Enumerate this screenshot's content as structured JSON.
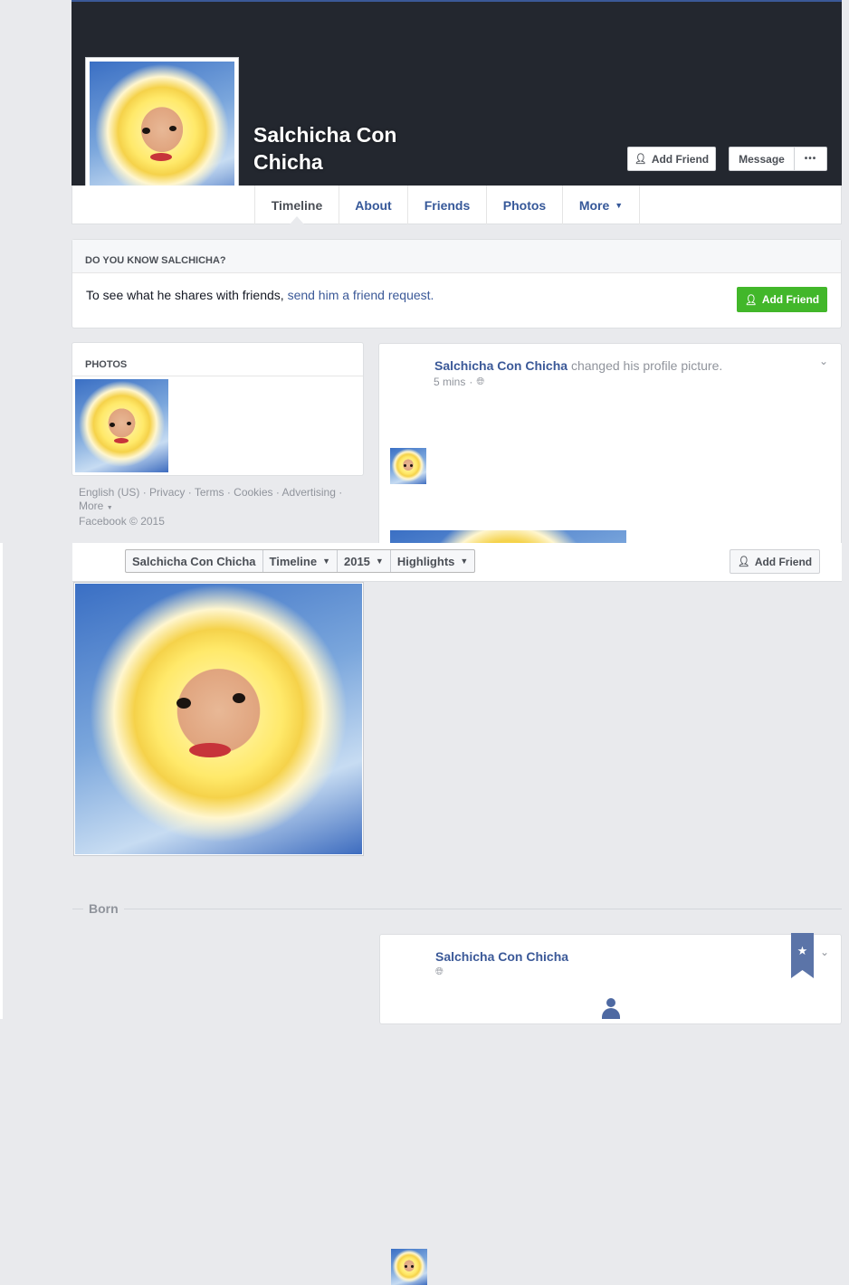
{
  "profile": {
    "name_line1": "Salchicha Con",
    "name_line2": "Chicha",
    "add_friend": "Add Friend",
    "message": "Message",
    "more_dots": "•••"
  },
  "tabs": [
    {
      "label": "Timeline"
    },
    {
      "label": "About"
    },
    {
      "label": "Friends"
    },
    {
      "label": "Photos"
    },
    {
      "label": "More"
    }
  ],
  "know_box": {
    "title": "DO YOU KNOW SALCHICHA?",
    "text": "To see what he shares with friends,",
    "link": "send him a friend request.",
    "button": "Add Friend"
  },
  "photos_box": {
    "title": "PHOTOS"
  },
  "footer": {
    "line1": [
      "English (US)",
      "Privacy",
      "Terms",
      "Cookies",
      "Advertising"
    ],
    "more": "More",
    "copyright": "Facebook © 2015"
  },
  "post1": {
    "author": "Salchicha Con Chicha",
    "action": "changed his profile picture.",
    "time": "5 mins"
  },
  "sticky_bar": {
    "name": "Salchicha Con Chicha",
    "timeline": "Timeline",
    "year": "2015",
    "highlights": "Highlights",
    "add_friend": "Add Friend"
  },
  "born": {
    "label": "Born"
  },
  "post2": {
    "author": "Salchicha Con Chicha"
  }
}
